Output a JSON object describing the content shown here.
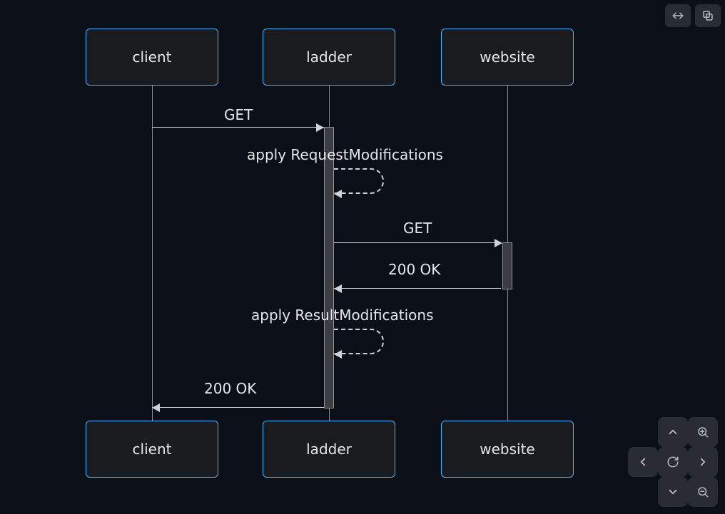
{
  "participants": {
    "client": "client",
    "ladder": "ladder",
    "website": "website"
  },
  "messages": {
    "m1": "GET",
    "m2": "apply RequestModifications",
    "m3": "GET",
    "m4": "200 OK",
    "m5": "apply ResultModifications",
    "m6": "200 OK"
  },
  "colors": {
    "bg": "#0b1018",
    "participantBorder": "#4db2ff",
    "participantBg": "#1a1b1e",
    "line": "#cfd3da"
  },
  "chart_data": {
    "type": "sequence-diagram",
    "participants": [
      "client",
      "ladder",
      "website"
    ],
    "steps": [
      {
        "from": "client",
        "to": "ladder",
        "label": "GET",
        "kind": "request"
      },
      {
        "from": "ladder",
        "to": "ladder",
        "label": "apply RequestModifications",
        "kind": "self"
      },
      {
        "from": "ladder",
        "to": "website",
        "label": "GET",
        "kind": "request"
      },
      {
        "from": "website",
        "to": "ladder",
        "label": "200 OK",
        "kind": "response"
      },
      {
        "from": "ladder",
        "to": "ladder",
        "label": "apply ResultModifications",
        "kind": "self"
      },
      {
        "from": "ladder",
        "to": "client",
        "label": "200 OK",
        "kind": "response"
      }
    ]
  }
}
